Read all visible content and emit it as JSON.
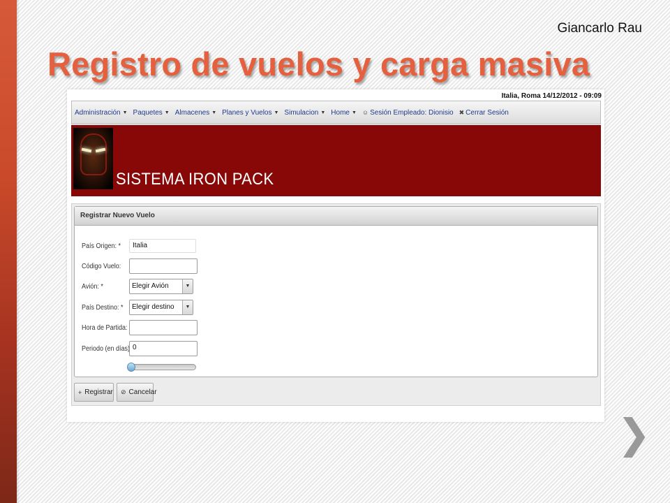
{
  "slide": {
    "author": "Giancarlo Rau",
    "title": "Registro de vuelos y carga masiva"
  },
  "app": {
    "datetime": "Italia, Roma 14/12/2012 - 09:09",
    "menu": [
      {
        "label": "Administración",
        "icon": "caret-down-icon"
      },
      {
        "label": "Paquetes",
        "icon": "caret-down-icon"
      },
      {
        "label": "Almacenes",
        "icon": "caret-down-icon"
      },
      {
        "label": "Planes y Vuelos",
        "icon": "caret-down-icon"
      },
      {
        "label": "Simulacion",
        "icon": "caret-down-icon"
      },
      {
        "label": "Home",
        "icon": "caret-down-icon"
      },
      {
        "label": "Sesión Empleado: Dionisio",
        "icon": "user-icon"
      },
      {
        "label": "Cerrar Sesión",
        "icon": "close-icon"
      }
    ],
    "system_name": "SISTEMA IRON PACK",
    "panel_title": "Registrar Nuevo Vuelo",
    "form": {
      "pais_origen": {
        "label": "País Origen: *",
        "value": "Italia"
      },
      "codigo_vuelo": {
        "label": "Código Vuelo:",
        "value": ""
      },
      "avion": {
        "label": "Avión: *",
        "value": "Elegir Avión"
      },
      "pais_destino": {
        "label": "País Destino: *",
        "value": "Elegir destino"
      },
      "hora_partida": {
        "label": "Hora de Partida: *",
        "value": ""
      },
      "periodo": {
        "label": "Periodo (en días): *",
        "value": "0"
      },
      "periodo_slider_level": 0
    },
    "buttons": {
      "registrar": "Registrar",
      "cancelar": "Cancelar"
    }
  }
}
